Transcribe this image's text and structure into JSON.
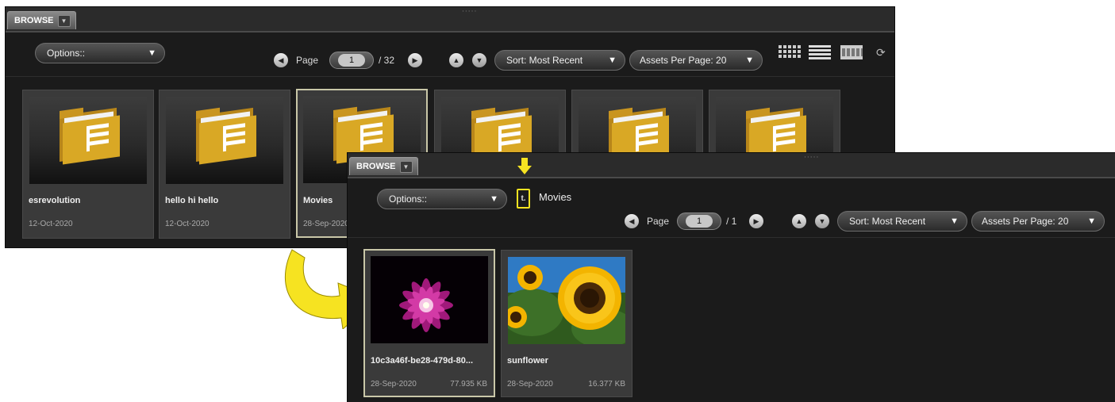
{
  "top_panel": {
    "tab_label": "BROWSE",
    "grip": "·····",
    "options_label": "Options::",
    "page_label": "Page",
    "page_value": "1",
    "page_total": "/ 32",
    "sort_label": "Sort: Most Recent",
    "assets_label": "Assets Per Page: 20",
    "tiles": [
      {
        "name": "esrevolution",
        "date": "12-Oct-2020"
      },
      {
        "name": "hello hi hello",
        "date": "12-Oct-2020"
      },
      {
        "name": "Movies",
        "date": "28-Sep-2020"
      },
      {
        "name": "",
        "date": ""
      },
      {
        "name": "",
        "date": ""
      },
      {
        "name": "",
        "date": ""
      }
    ]
  },
  "bottom_panel": {
    "tab_label": "BROWSE",
    "grip": "·····",
    "options_label": "Options::",
    "up_icon_glyph": "t.",
    "breadcrumb": "Movies",
    "page_label": "Page",
    "page_value": "1",
    "page_total": "/ 1",
    "sort_label": "Sort: Most Recent",
    "assets_label": "Assets Per Page: 20",
    "tiles": [
      {
        "name": "10c3a46f-be28-479d-80...",
        "date": "28-Sep-2020",
        "size": "77.935 KB"
      },
      {
        "name": "sunflower",
        "date": "28-Sep-2020",
        "size": "16.377 KB"
      }
    ]
  },
  "colors": {
    "annotation_yellow": "#f6e321",
    "panel_bg": "#1b1b1b",
    "folder_gold": "#d9a825"
  }
}
